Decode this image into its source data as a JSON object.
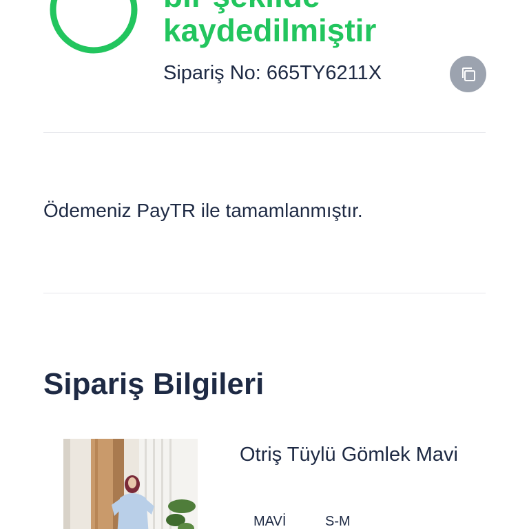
{
  "success": {
    "headline_line1": "bir şekilde",
    "headline_line2": "kaydedilmiştir",
    "order_no": "Sipariş No: 665TY6211X",
    "accent_color": "#22c55e",
    "check_icon": "check-circle-icon",
    "copy_icon": "copy-icon"
  },
  "payment": {
    "message": "Ödemeniz PayTR ile tamamlanmıştır."
  },
  "order_info": {
    "title": "Sipariş Bilgileri",
    "items": [
      {
        "name": "Otriş Tüylü Gömlek Mavi",
        "color": "MAVİ",
        "size": "S-M"
      }
    ]
  }
}
